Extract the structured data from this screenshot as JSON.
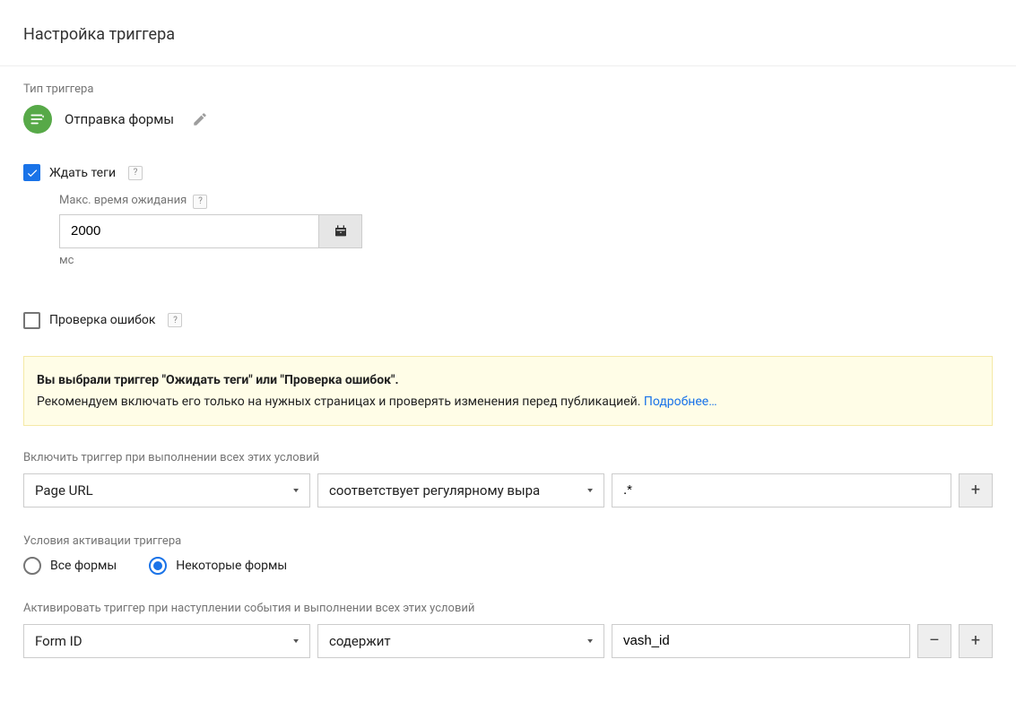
{
  "page_title": "Настройка триггера",
  "trigger_type": {
    "label": "Тип триггера",
    "name": "Отправка формы"
  },
  "wait_tags": {
    "label": "Ждать теги",
    "help": "?",
    "timeout_label": "Макс. время ожидания",
    "timeout_help": "?",
    "timeout_value": "2000",
    "unit": "мс"
  },
  "check_errors": {
    "label": "Проверка ошибок",
    "help": "?"
  },
  "info": {
    "title": "Вы выбрали триггер \"Ожидать теги\" или \"Проверка ошибок\".",
    "body": "Рекомендуем включать его только на нужных страницах и проверять изменения перед публикацией. ",
    "link": "Подробнее…"
  },
  "enable_conditions": {
    "label": "Включить триггер при выполнении всех этих условий",
    "rows": [
      {
        "variable": "Page URL",
        "operator": "соответствует регулярному выра",
        "value": ".*"
      }
    ]
  },
  "activation": {
    "label": "Условия активации триггера",
    "option_all": "Все формы",
    "option_some": "Некоторые формы"
  },
  "fire_conditions": {
    "label": "Активировать триггер при наступлении события и выполнении всех этих условий",
    "rows": [
      {
        "variable": "Form ID",
        "operator": "содержит",
        "value": "vash_id"
      }
    ]
  },
  "buttons": {
    "plus": "+",
    "minus": "–"
  }
}
